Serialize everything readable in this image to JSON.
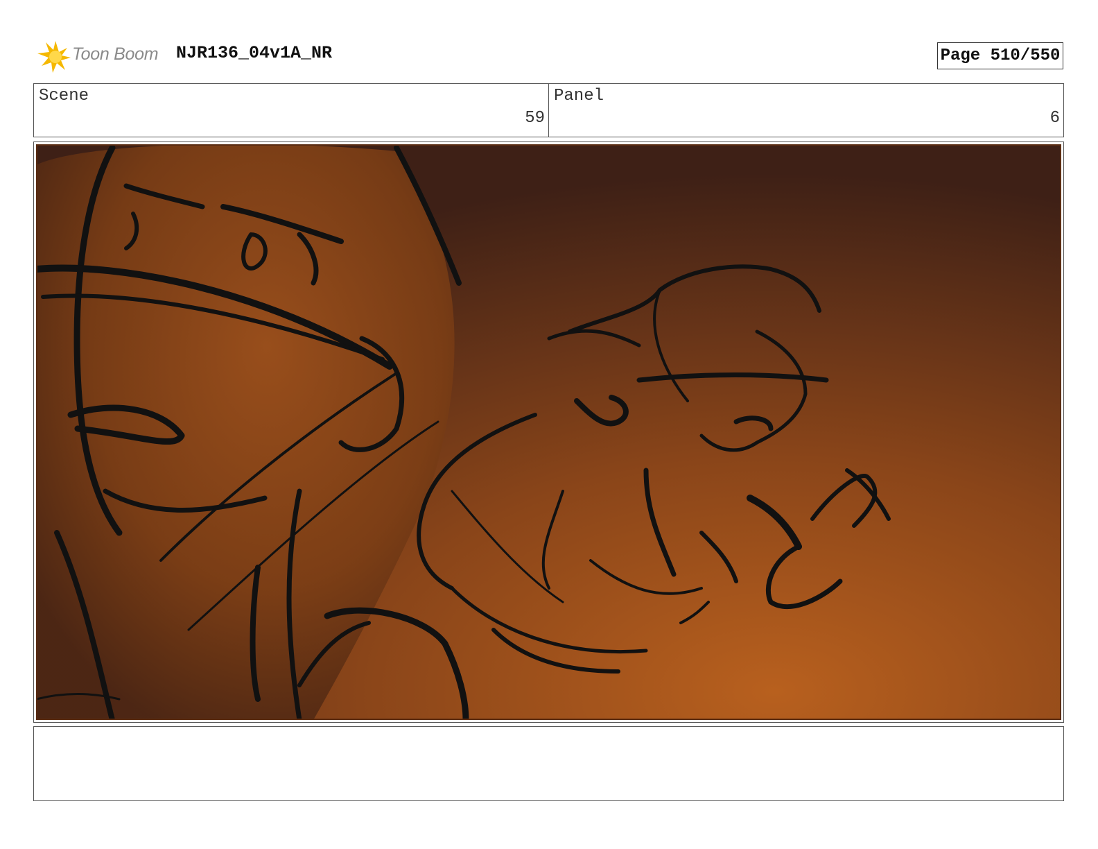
{
  "header": {
    "logo_text": "Toon Boom",
    "doc_title": "NJR136_04v1A_NR",
    "page_label": "Page 510/550"
  },
  "info": {
    "scene_label": "Scene",
    "scene_value": "59",
    "panel_label": "Panel",
    "panel_value": "6"
  },
  "panel": {
    "image": "rough storyboard sketch: close-up of a masked figure in the left foreground, a running woman with flowing hair in the midground, warm orange-brown smoky background"
  },
  "notes": {
    "text": ""
  }
}
